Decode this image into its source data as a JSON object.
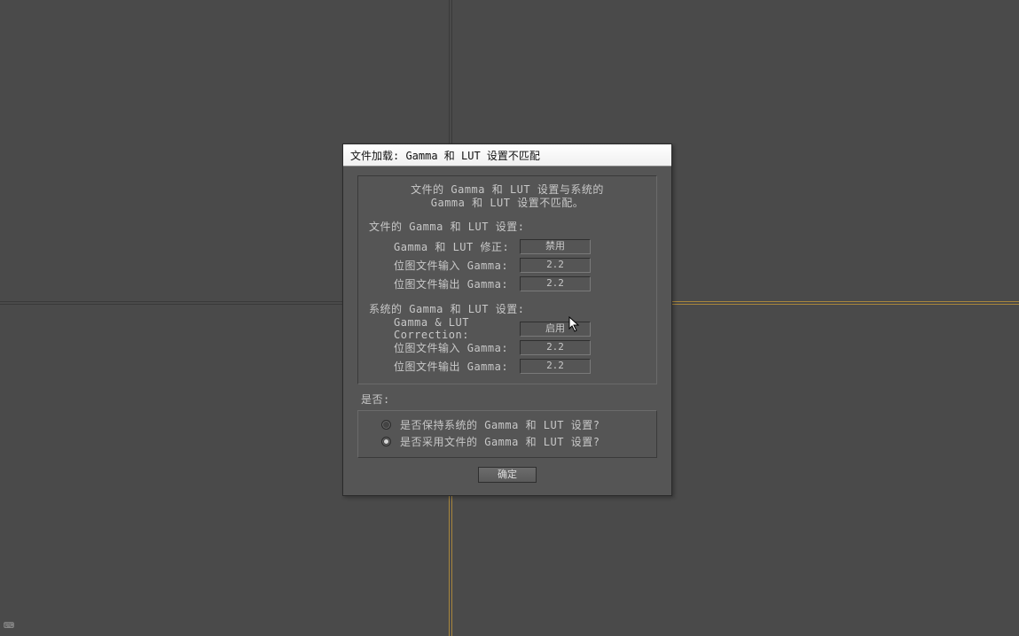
{
  "dialog": {
    "title": "文件加载: Gamma 和 LUT 设置不匹配",
    "message_line1": "文件的 Gamma 和 LUT 设置与系统的",
    "message_line2": "Gamma 和 LUT 设置不匹配。",
    "file_section": {
      "header": "文件的 Gamma 和 LUT 设置:",
      "correction_label": "Gamma 和 LUT 修正:",
      "correction_value": "禁用",
      "input_label": "位图文件输入 Gamma:",
      "input_value": "2.2",
      "output_label": "位图文件输出 Gamma:",
      "output_value": "2.2"
    },
    "system_section": {
      "header": "系统的 Gamma 和 LUT 设置:",
      "correction_label": "Gamma & LUT Correction:",
      "correction_value": "启用",
      "input_label": "位图文件输入 Gamma:",
      "input_value": "2.2",
      "output_label": "位图文件输出 Gamma:",
      "output_value": "2.2"
    },
    "question": "是否:",
    "radio1": "是否保持系统的 Gamma 和 LUT 设置?",
    "radio2": "是否采用文件的 Gamma 和 LUT 设置?",
    "selected_radio": 2,
    "ok_label": "确定"
  }
}
